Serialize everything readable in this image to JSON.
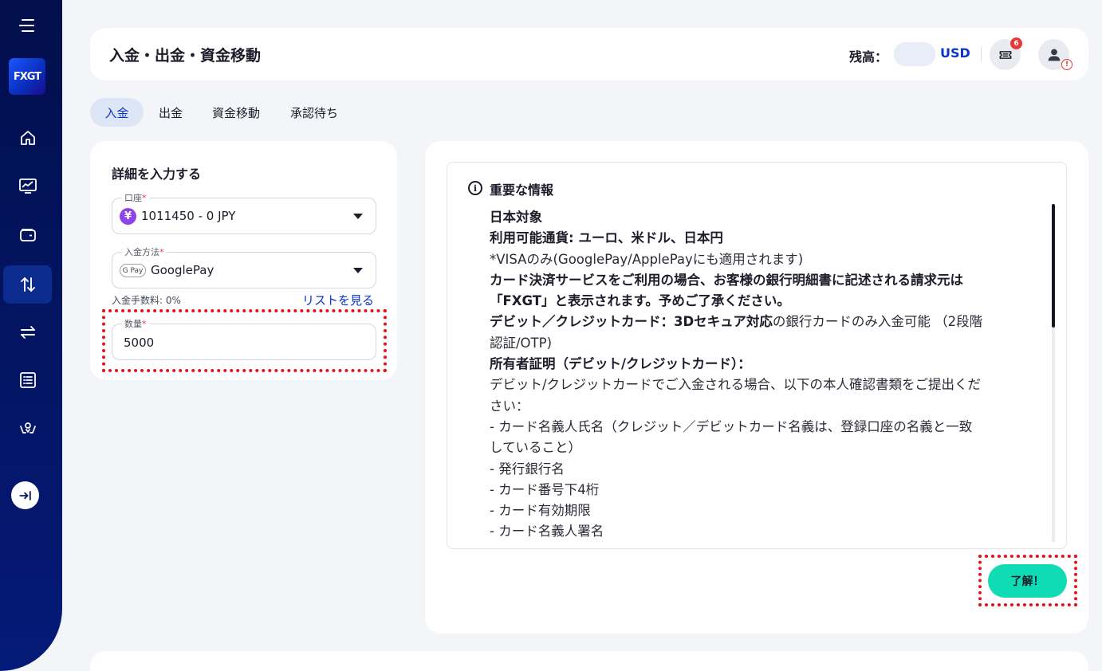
{
  "sidebar": {
    "logo": "FXGT",
    "items": [
      {
        "icon": "home-icon"
      },
      {
        "icon": "chart-monitor-icon"
      },
      {
        "icon": "wallet-icon"
      },
      {
        "icon": "transfer-arrows-icon",
        "active": true
      },
      {
        "icon": "swap-icon"
      },
      {
        "icon": "list-icon"
      },
      {
        "icon": "bonus-icon"
      }
    ],
    "collapse_icon": "expand-arrow-icon"
  },
  "header": {
    "title": "入金・出金・資金移動",
    "balance_label": "残高：",
    "balance_currency": "USD",
    "notification_count": "6",
    "warning_mark": "!"
  },
  "tabs": [
    {
      "label": "入金",
      "active": true
    },
    {
      "label": "出金"
    },
    {
      "label": "資金移動"
    },
    {
      "label": "承認待ち"
    }
  ],
  "form": {
    "title": "詳細を入力する",
    "account": {
      "label": "口座",
      "required": "*",
      "value": "1011450 - 0 JPY",
      "icon_text": "¥"
    },
    "method": {
      "label": "入金方法",
      "required": "*",
      "value": "GooglePay",
      "icon_text": "G Pay"
    },
    "fee_text": "入金手数料: 0%",
    "list_link": "リストを見る",
    "amount": {
      "label": "数量",
      "required": "*",
      "value": "5000"
    }
  },
  "info": {
    "header": "重要な情報",
    "info_icon": "i",
    "lines": [
      {
        "t": "日本対象",
        "b": true
      },
      {
        "t": "利用可能通貨: ユーロ、米ドル、日本円",
        "b": true
      },
      {
        "t": "*VISAのみ(GooglePay/ApplePayにも適用されます)",
        "b": false
      },
      {
        "t": "カード決済サービスをご利用の場合、お客様の銀行明細書に記述される請求元は",
        "b": true
      },
      {
        "t": "「FXGT」と表示されます。予めご了承ください。",
        "b": true
      },
      {
        "t": "デビット／クレジットカード：3Dセキュア対応",
        "b": true,
        "rest": "の銀行カードのみ入金可能 （2段階"
      },
      {
        "t": "認証/OTP)",
        "b": false
      },
      {
        "t": "所有者証明（デビット/クレジットカード）：",
        "b": true
      },
      {
        "t": "デビット/クレジットカードでご入金される場合、以下の本人確認書類をご提出くだ",
        "b": false
      },
      {
        "t": "さい：",
        "b": false
      },
      {
        "t": "- カード名義人氏名（クレジット／デビットカード名義は、登録口座の名義と一致",
        "b": false
      },
      {
        "t": "していること）",
        "b": false
      },
      {
        "t": "- 発行銀行名",
        "b": false
      },
      {
        "t": "- カード番号下4桁",
        "b": false
      },
      {
        "t": "- カード有効期限",
        "b": false
      },
      {
        "t": "- カード名義人署名",
        "b": false
      }
    ],
    "ok_button": "了解！"
  },
  "colors": {
    "sidebar_top": "#020f4c",
    "sidebar_bottom": "#041a78",
    "accent_blue": "#0a35c8",
    "ok_button": "#0fdcb5",
    "highlight": "#e8121b"
  }
}
